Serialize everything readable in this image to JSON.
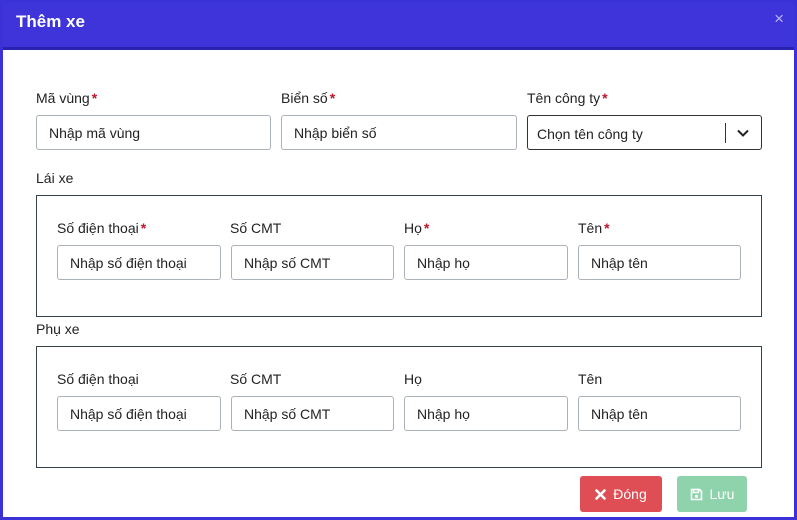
{
  "modal": {
    "title": "Thêm xe",
    "close_symbol": "×",
    "close_icon": "close-x-icon"
  },
  "vehicle": {
    "region_code": {
      "label": "Mã vùng",
      "required_mark": "*",
      "placeholder": "Nhập mã vùng",
      "value": ""
    },
    "plate": {
      "label": "Biển số",
      "required_mark": "*",
      "placeholder": "Nhập biển số",
      "value": ""
    },
    "company": {
      "label": "Tên công ty",
      "required_mark": "*",
      "selected": "Chọn tên công ty",
      "icon": "chevron-down-icon"
    }
  },
  "driver": {
    "section_label": "Lái xe",
    "phone": {
      "label": "Số điện thoại",
      "required_mark": "*",
      "placeholder": "Nhập số điện thoại"
    },
    "id_card": {
      "label": "Số CMT",
      "placeholder": "Nhập số CMT"
    },
    "last_name": {
      "label": "Họ",
      "required_mark": "*",
      "placeholder": "Nhập họ"
    },
    "first_name": {
      "label": "Tên",
      "required_mark": "*",
      "placeholder": "Nhập tên"
    }
  },
  "assistant": {
    "section_label": "Phụ xe",
    "phone": {
      "label": "Số điện thoại",
      "placeholder": "Nhập số điện thoại"
    },
    "id_card": {
      "label": "Số CMT",
      "placeholder": "Nhập số CMT"
    },
    "last_name": {
      "label": "Họ",
      "placeholder": "Nhập họ"
    },
    "first_name": {
      "label": "Tên",
      "placeholder": "Nhập tên"
    }
  },
  "footer": {
    "close_label": "Đóng",
    "close_icon": "x-icon",
    "save_label": "Lưu",
    "save_icon": "floppy-disk-icon"
  },
  "colors": {
    "header": "#3f34d9",
    "required": "#c0142b",
    "close_button": "#de4e54",
    "save_button": "#8fd3ac"
  }
}
